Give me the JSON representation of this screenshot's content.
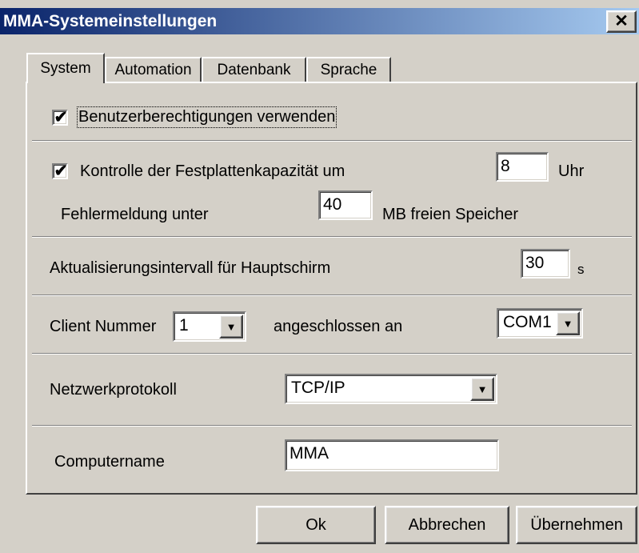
{
  "window": {
    "title": "MMA-Systemeinstellungen",
    "close_glyph": "✕"
  },
  "tabs": [
    {
      "label": "System"
    },
    {
      "label": "Automation"
    },
    {
      "label": "Datenbank"
    },
    {
      "label": "Sprache"
    }
  ],
  "system": {
    "user_permissions": {
      "label": "Benutzerberechtigungen verwenden",
      "checked": true,
      "check_glyph": "✔"
    },
    "disk_check": {
      "label": "Kontrolle der Festplattenkapazität um",
      "checked": true,
      "check_glyph": "✔",
      "hour_value": "8",
      "hour_unit": "Uhr"
    },
    "error_message": {
      "label": "Fehlermeldung unter",
      "value": "40",
      "unit": "MB freien Speicher"
    },
    "refresh_interval": {
      "label": "Aktualisierungsintervall für Hauptschirm",
      "value": "30",
      "unit": "s"
    },
    "client": {
      "label": "Client Nummer",
      "number": "1",
      "connected_label": "angeschlossen an",
      "port": "COM1"
    },
    "network": {
      "label": "Netzwerkprotokoll",
      "value": "TCP/IP"
    },
    "computer": {
      "label": "Computername",
      "value": "MMA"
    }
  },
  "buttons": {
    "ok": "Ok",
    "cancel": "Abbrechen",
    "apply": "Übernehmen"
  },
  "icons": {
    "dropdown_glyph": "▼"
  },
  "colors": {
    "titlebar_start": "#0a246a",
    "titlebar_end": "#a6caf0",
    "face": "#d4d0c8"
  }
}
